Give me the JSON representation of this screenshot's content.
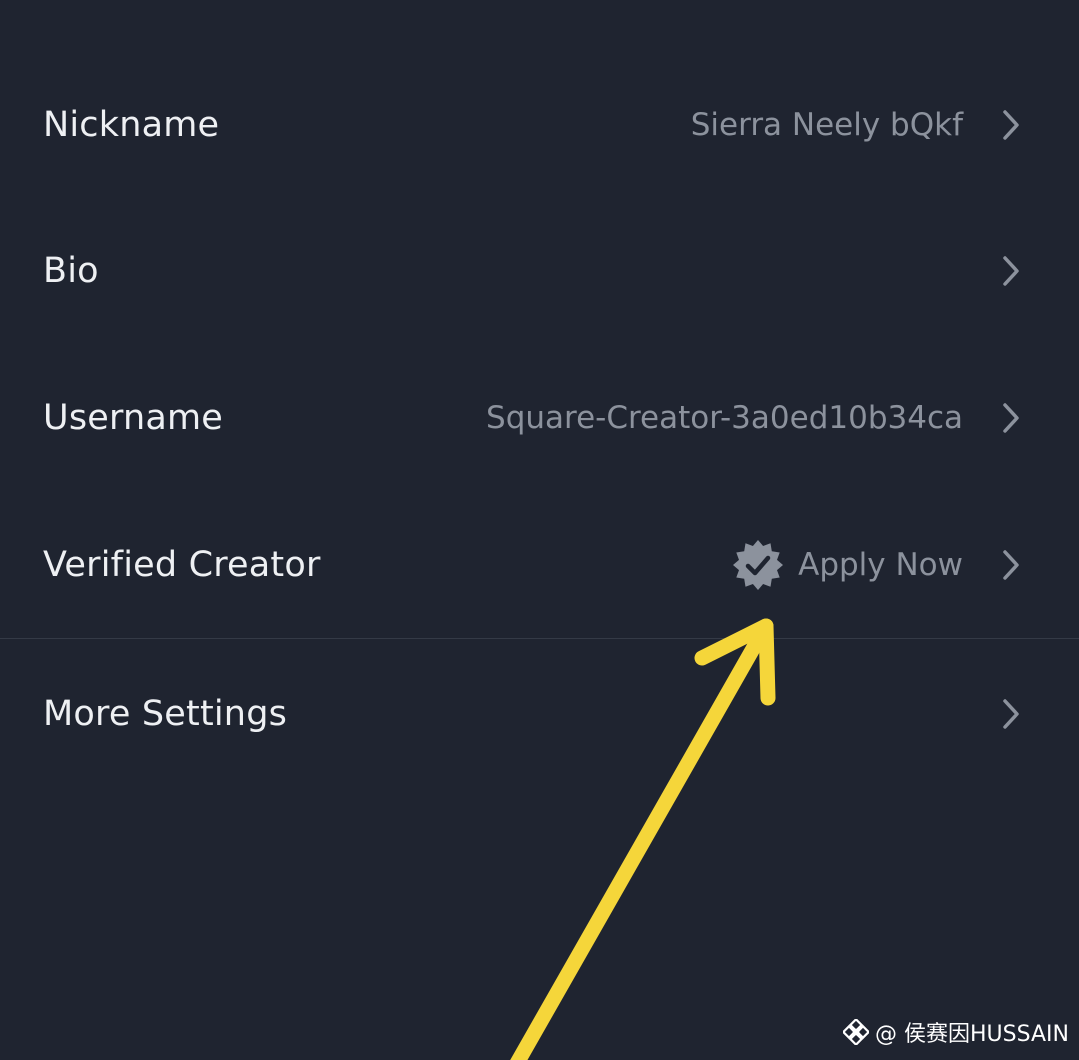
{
  "settings": {
    "nickname": {
      "label": "Nickname",
      "value": "Sierra Neely bQkf"
    },
    "bio": {
      "label": "Bio"
    },
    "username": {
      "label": "Username",
      "value": "Square-Creator-3a0ed10b34ca"
    },
    "verified": {
      "label": "Verified Creator",
      "value": "Apply Now",
      "icon": "verified-badge-icon"
    },
    "more": {
      "label": "More Settings"
    }
  },
  "watermark": {
    "text": "@ 侯赛因HUSSAIN",
    "icon": "binance-logo-icon"
  },
  "colors": {
    "background": "#1f2430",
    "label": "#eef0f3",
    "value": "#8c929d",
    "arrow": "#f5d63a"
  }
}
